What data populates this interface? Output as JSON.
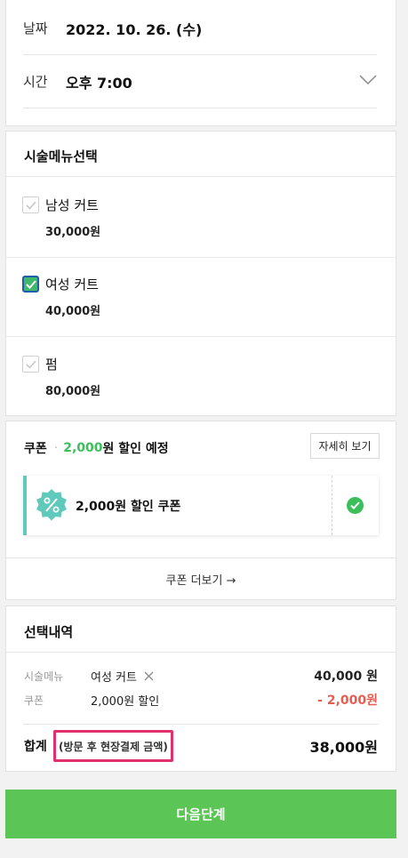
{
  "schedule": {
    "date_label": "날짜",
    "date_value": "2022. 10. 26. (수)",
    "time_label": "시간",
    "time_value": "오후 7:00"
  },
  "menu": {
    "title": "시술메뉴선택",
    "items": [
      {
        "name": "남성 커트",
        "price": "30,000원",
        "checked": false
      },
      {
        "name": "여성 커트",
        "price": "40,000원",
        "checked": true
      },
      {
        "name": "펌",
        "price": "80,000원",
        "checked": false
      }
    ]
  },
  "coupon": {
    "title": "쿠폰",
    "discount_amount": "2,000",
    "discount_suffix": "원 할인 예정",
    "detail_button": "자세히 보기",
    "item_name": "2,000원 할인 쿠폰",
    "more_button": "쿠폰 더보기 →"
  },
  "summary": {
    "title": "선택내역",
    "rows": [
      {
        "label": "시술메뉴",
        "value": "여성 커트",
        "amount": "40,000 원"
      },
      {
        "label": "쿠폰",
        "value": "2,000원 할인",
        "amount": "- 2,000원"
      }
    ],
    "total_label": "합계",
    "total_note": "(방문 후 현장결제 금액)",
    "total_amount": "38,000원"
  },
  "next_button": "다음단계",
  "colors": {
    "accent_green": "#5bc555",
    "discount_red": "#e85d4f",
    "highlight_pink": "#e1306c",
    "coupon_teal": "#5fcabb"
  }
}
